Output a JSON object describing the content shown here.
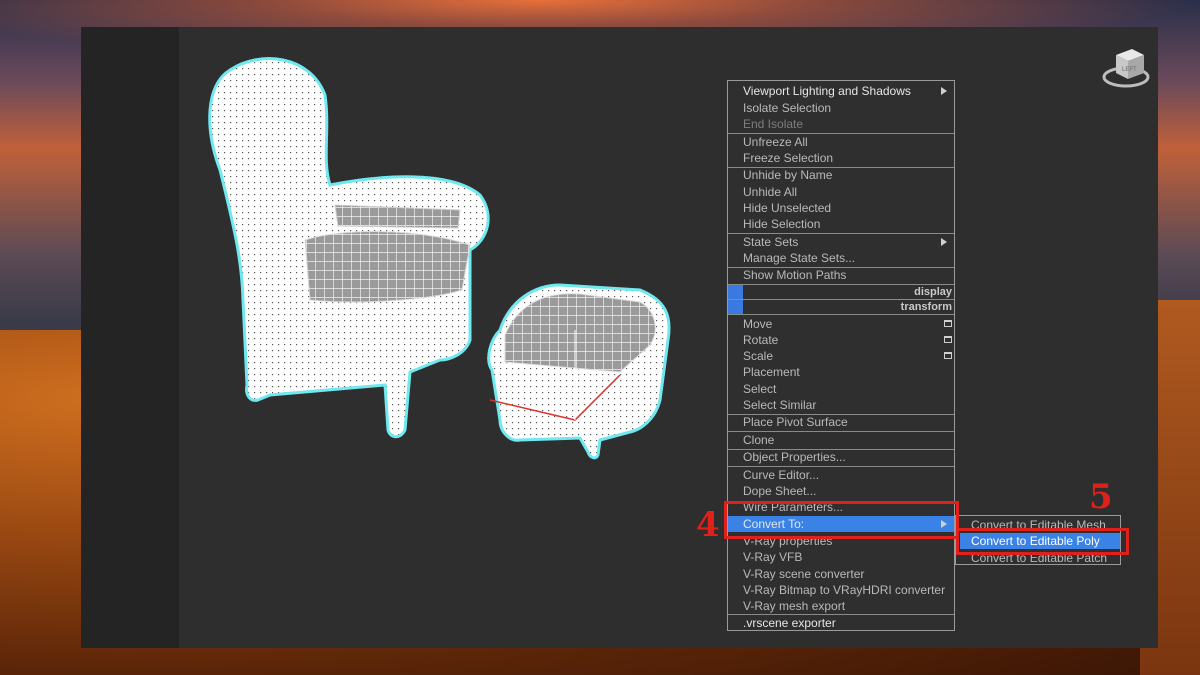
{
  "menu": {
    "items": [
      {
        "label": "Viewport Lighting and Shadows",
        "state": "normal",
        "submenu": true
      },
      {
        "label": "Isolate Selection",
        "state": "normal"
      },
      {
        "label": "End Isolate",
        "state": "disabled"
      },
      {
        "label": "Unfreeze All",
        "state": "normal"
      },
      {
        "label": "Freeze Selection",
        "state": "normal"
      },
      {
        "label": "Unhide by Name",
        "state": "normal"
      },
      {
        "label": "Unhide All",
        "state": "normal"
      },
      {
        "label": "Hide Unselected",
        "state": "normal"
      },
      {
        "label": "Hide Selection",
        "state": "normal"
      },
      {
        "label": "State Sets",
        "state": "normal",
        "submenu": true
      },
      {
        "label": "Manage State Sets...",
        "state": "normal"
      },
      {
        "label": "Show Motion Paths",
        "state": "normal"
      },
      {
        "label": "display",
        "state": "header"
      },
      {
        "label": "transform",
        "state": "header"
      },
      {
        "label": "Move",
        "state": "normal"
      },
      {
        "label": "Rotate",
        "state": "normal"
      },
      {
        "label": "Scale",
        "state": "normal"
      },
      {
        "label": "Placement",
        "state": "normal"
      },
      {
        "label": "Select",
        "state": "normal"
      },
      {
        "label": "Select Similar",
        "state": "normal"
      },
      {
        "label": "Place Pivot Surface",
        "state": "normal"
      },
      {
        "label": "Clone",
        "state": "normal"
      },
      {
        "label": "Object Properties...",
        "state": "normal"
      },
      {
        "label": "Curve Editor...",
        "state": "normal"
      },
      {
        "label": "Dope Sheet...",
        "state": "normal"
      },
      {
        "label": "Wire Parameters...",
        "state": "normal"
      },
      {
        "label": "Convert To:",
        "state": "highlighted",
        "submenu": true
      },
      {
        "label": "V-Ray properties",
        "state": "normal"
      },
      {
        "label": "V-Ray VFB",
        "state": "normal"
      },
      {
        "label": "V-Ray scene converter",
        "state": "normal"
      },
      {
        "label": "V-Ray Bitmap to VRayHDRI converter",
        "state": "normal"
      },
      {
        "label": "V-Ray mesh export",
        "state": "normal"
      },
      {
        "label": ".vrscene exporter",
        "state": "normal"
      }
    ]
  },
  "submenu": {
    "items": [
      {
        "label": "Convert to Editable Mesh",
        "state": "normal"
      },
      {
        "label": "Convert to Editable Poly",
        "state": "highlighted"
      },
      {
        "label": "Convert to Editable Patch",
        "state": "normal"
      }
    ]
  },
  "annotations": {
    "step4": "4",
    "step5": "5",
    "color": "#e0201a"
  },
  "viewcube": {
    "face_label": "LEFT"
  },
  "colors": {
    "highlight": "#3a82e6",
    "wireframe": "#6fe8f0",
    "viewport_bg": "#2e2e2e"
  }
}
